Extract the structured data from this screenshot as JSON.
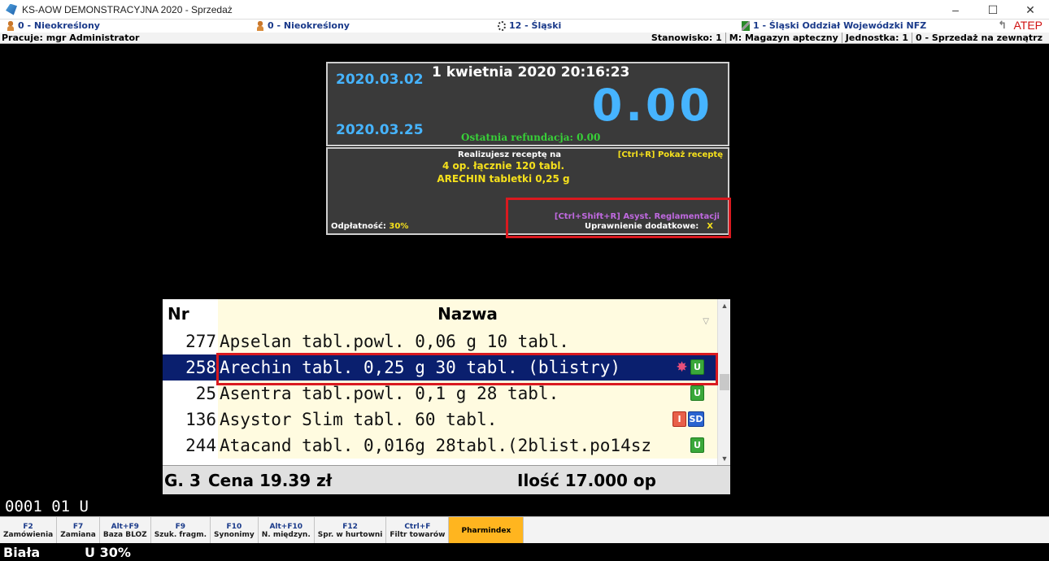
{
  "window": {
    "title": "KS-AOW DEMONSTRACYJNA 2020 - Sprzedaż",
    "minimize": "–",
    "maximize": "☐",
    "close": "✕"
  },
  "info": {
    "doctor": "0 - Nieokreślony",
    "patient": "0 - Nieokreślony",
    "branch": "12 - Śląski",
    "nfz": "1 - Śląski Oddział Wojewódzki NFZ",
    "atep": "ATEP",
    "user": "Pracuje: mgr Administrator",
    "stanowisko": "Stanowisko: 1",
    "magazyn": "M: Magazyn apteczny",
    "jednostka": "Jednostka: 1",
    "sprzedaz": "0 - Sprzedaż na zewnątrz"
  },
  "top_panel": {
    "date1": "2020.03.02",
    "date2": "2020.03.25",
    "datetime": "1 kwietnia 2020  20:16:23",
    "amount": "0.00",
    "refund": "Ostatnia refundacja: 0.00"
  },
  "rx_panel": {
    "line1": "Realizujesz receptę na",
    "ctrl_r": "[Ctrl+R] Pokaż receptę",
    "line2": "4 op. łącznie 120 tabl.",
    "line3": "ARECHIN tabletki 0,25 g",
    "odplatnosc_label": "Odpłatność:",
    "odplatnosc_value": "30%",
    "asyst": "[Ctrl+Shift+R] Asyst. Reglamentacji",
    "uprawnienie_label": "Uprawnienie dodatkowe:",
    "uprawnienie_value": "X"
  },
  "list": {
    "col_nr": "Nr",
    "col_name": "Nazwa",
    "rows": [
      {
        "nr": "277",
        "name": "Apselan tabl.powl. 0,06 g 10 tabl.",
        "badges": []
      },
      {
        "nr": "258",
        "name": "Arechin tabl. 0,25 g 30 tabl. (blistry)",
        "badges": [
          "star-icon",
          "U"
        ]
      },
      {
        "nr": "25",
        "name": "Asentra tabl.powl. 0,1 g 28 tabl.",
        "badges": [
          "U"
        ]
      },
      {
        "nr": "136",
        "name": "Asystor Slim tabl. 60 tabl.",
        "badges": [
          "I",
          "SD"
        ]
      },
      {
        "nr": "244",
        "name": "Atacand tabl. 0,016g 28tabl.(2blist.po14sz",
        "badges": [
          "U"
        ]
      }
    ],
    "footer_g": "G. 3",
    "footer_cena": "Cena 19.39 zł",
    "footer_ilosc": "Ilość 17.000 op"
  },
  "status_code": "0001 01  U",
  "fkeys": [
    {
      "key": "F2",
      "label": "Zamówienia"
    },
    {
      "key": "F7",
      "label": "Zamiana"
    },
    {
      "key": "Alt+F9",
      "label": "Baza BLOZ"
    },
    {
      "key": "F9",
      "label": "Szuk. fragm."
    },
    {
      "key": "F10",
      "label": "Synonimy"
    },
    {
      "key": "Alt+F10",
      "label": "N. międzyn."
    },
    {
      "key": "F12",
      "label": "Spr. w hurtowni"
    },
    {
      "key": "Ctrl+F",
      "label": "Filtr towarów"
    },
    {
      "key": "",
      "label": "Pharmindex"
    }
  ],
  "bottom": {
    "left": "Biała",
    "right": "U 30%"
  },
  "colors": {
    "accent_blue": "#46b4ff",
    "highlight_red": "#d9191f",
    "selection_navy": "#0a1f6e",
    "pharmindex_orange": "#ffb51f"
  }
}
